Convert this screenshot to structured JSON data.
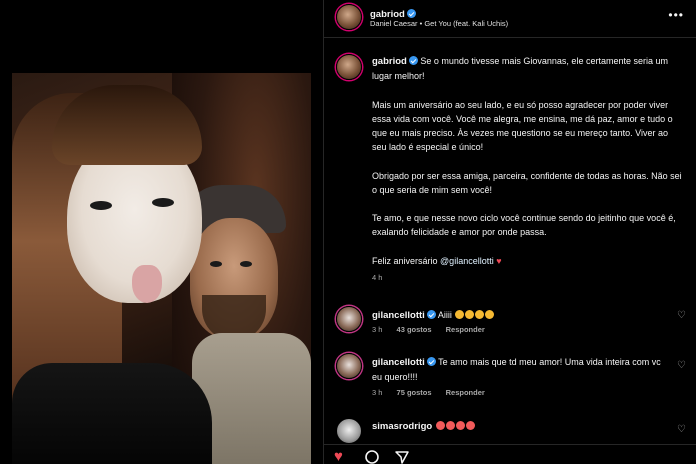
{
  "post": {
    "author": "gabriod",
    "audio": "Daniel Caesar • Get You (feat. Kali Uchis)",
    "more_label": "•••"
  },
  "caption": {
    "author": "gabriod",
    "p1": "Se o mundo tivesse mais Giovannas, ele certamente seria um lugar melhor!",
    "p2": "Mais um aniversário ao seu lado, e eu só posso agradecer por poder viver essa vida com você. Você me alegra, me ensina, me dá paz, amor e tudo o que eu mais preciso. Às vezes me questiono se eu mereço tanto. Viver ao seu lado é especial e único!",
    "p3": "Obrigado por ser essa amiga, parceira, confidente de todas as horas. Não sei o que seria de mim sem você!",
    "p4": "Te amo, e que nesse novo ciclo você continue sendo do jeitinho que você é, exalando felicidade e amor por onde passa.",
    "p5_prefix": "Feliz aniversário",
    "p5_mention": "@gilancellotti",
    "p5_heart": "♥",
    "time": "4 h"
  },
  "comments": [
    {
      "username": "gilancellotti",
      "text": "Aiiii",
      "time": "3 h",
      "likes": "43 gostos",
      "reply": "Responder"
    },
    {
      "username": "gilancellotti",
      "text": "Te amo mais que td meu amor! Uma vida inteira com vc eu quero!!!!",
      "time": "3 h",
      "likes": "75 gostos",
      "reply": "Responder"
    },
    {
      "username": "simasrodrigo",
      "text": ""
    }
  ],
  "icons": {
    "like": "heart-icon",
    "comment": "comment-icon",
    "share": "share-icon",
    "more": "more-options-icon",
    "verified": "verified-badge-icon"
  },
  "colors": {
    "background": "#000000",
    "verified": "#3897f0",
    "like_active": "#ed4956",
    "muted_text": "#a8a8a8"
  }
}
